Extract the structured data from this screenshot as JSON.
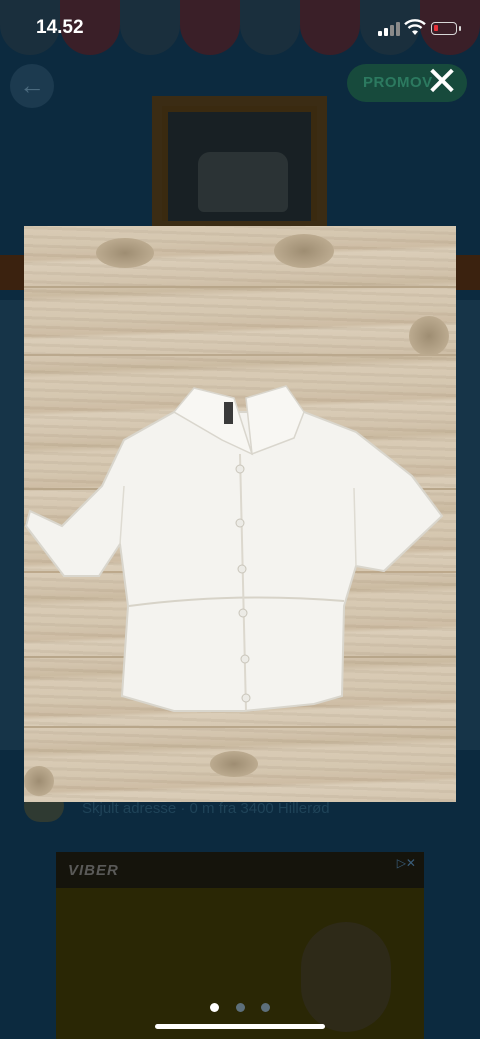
{
  "status_bar": {
    "time": "14.52"
  },
  "viewer": {
    "close_icon": "close-icon",
    "photo_alt": "White short-sleeve cropped shirt on wooden floor",
    "pages": 3,
    "active_page": 1
  },
  "background": {
    "promo_label": "PROMOV",
    "back_icon": "arrow-left-icon",
    "address": "Skjult adresse · 0 m fra 3400 Hillerød",
    "ad_brand": "VIBER"
  },
  "colors": {
    "overlay_bg": "#0c2a3f",
    "battery_low": "#e8323a"
  }
}
